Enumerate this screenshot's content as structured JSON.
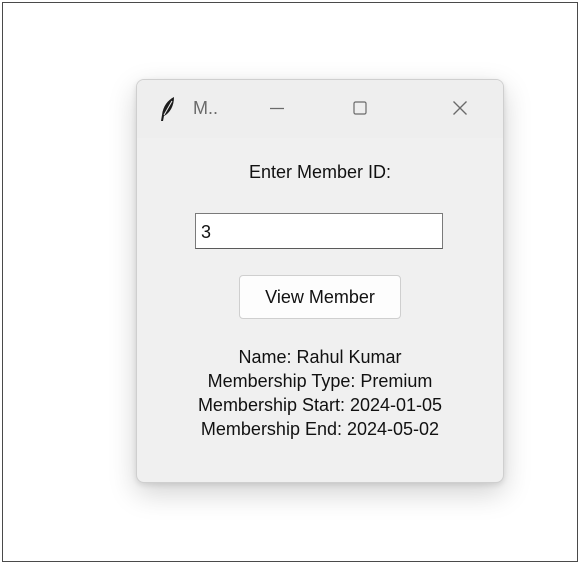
{
  "window": {
    "title": "M..",
    "icon": "feather-icon",
    "controls": {
      "minimize_icon": "minimize-icon",
      "maximize_icon": "maximize-icon",
      "close_icon": "close-icon"
    }
  },
  "form": {
    "prompt_label": "Enter Member ID:",
    "member_id_value": "3",
    "view_button_label": "View Member"
  },
  "member": {
    "name_line": "Name: Rahul Kumar",
    "type_line": "Membership Type: Premium",
    "start_line": "Membership Start: 2024-01-05",
    "end_line": "Membership End: 2024-05-02"
  }
}
